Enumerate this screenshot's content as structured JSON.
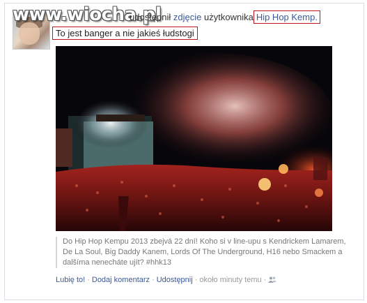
{
  "watermark": "www.wiocha.pl",
  "post": {
    "verb_text": "udostępnił",
    "object_link": "zdjęcie",
    "owner_text": "użytkownika",
    "owner_page": "Hip Hop Kemp.",
    "comment": "To jest banger a nie jakieś łudstogi",
    "caption": "Do Hip Hop Kempu 2013 zbejvá 22 dní! Koho si v line-upu s Kendrickem Lamarem, De La Soul, Big Daddy Kanem, Lords Of The Underground, H16 nebo Smackem a dalšíma nenecháte ujít? #hhk13"
  },
  "actions": {
    "like": "Lubię to!",
    "comment": "Dodaj komentarz",
    "share": "Udostępnij",
    "time": "około minuty temu"
  },
  "icons": {
    "audience": "friends-icon"
  },
  "colors": {
    "link": "#3b5998",
    "highlight_border": "#c0121a"
  }
}
